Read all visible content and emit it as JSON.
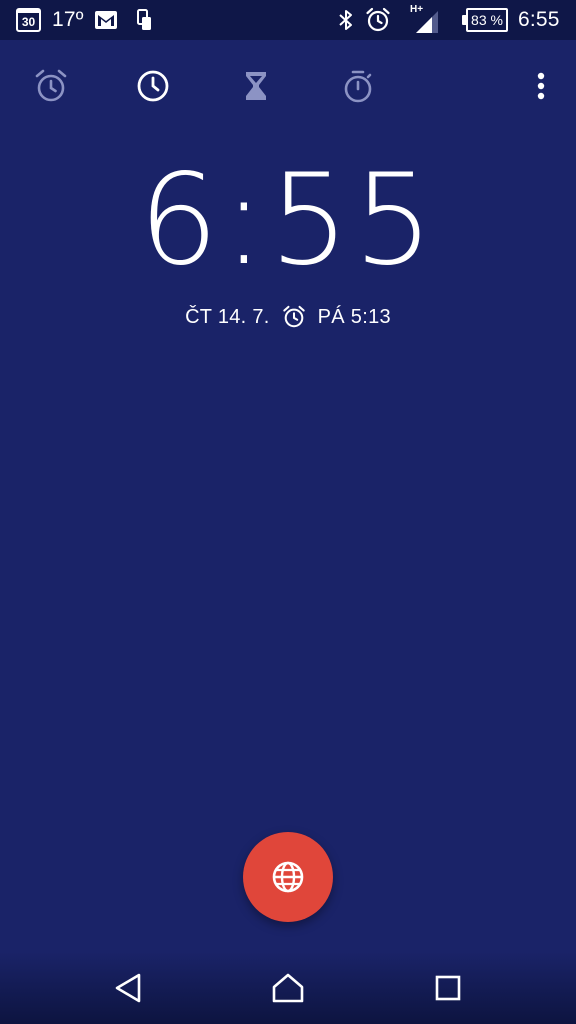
{
  "status_bar": {
    "calendar_day": "30",
    "temperature": "17º",
    "battery_percent": "83 %",
    "time": "6:55",
    "network_type": "H+",
    "icons": [
      "calendar-icon",
      "mail-icon",
      "phone-icon",
      "bluetooth-icon",
      "alarm-icon",
      "signal-icon",
      "battery-icon"
    ]
  },
  "tabs": [
    {
      "name": "alarm",
      "icon": "alarm-icon",
      "active": false
    },
    {
      "name": "clock",
      "icon": "clock-icon",
      "active": true
    },
    {
      "name": "timer",
      "icon": "hourglass-icon",
      "active": false
    },
    {
      "name": "stopwatch",
      "icon": "stopwatch-icon",
      "active": false
    }
  ],
  "clock": {
    "time": "6:55",
    "date": "ČT 14. 7.",
    "next_alarm": "PÁ 5:13"
  },
  "fab": {
    "icon": "globe-icon",
    "color": "#e0463a"
  },
  "colors": {
    "background": "#1a2368",
    "status_bar": "#0f1748",
    "tab_inactive": "#8c93c4",
    "tab_active": "#ffffff"
  }
}
